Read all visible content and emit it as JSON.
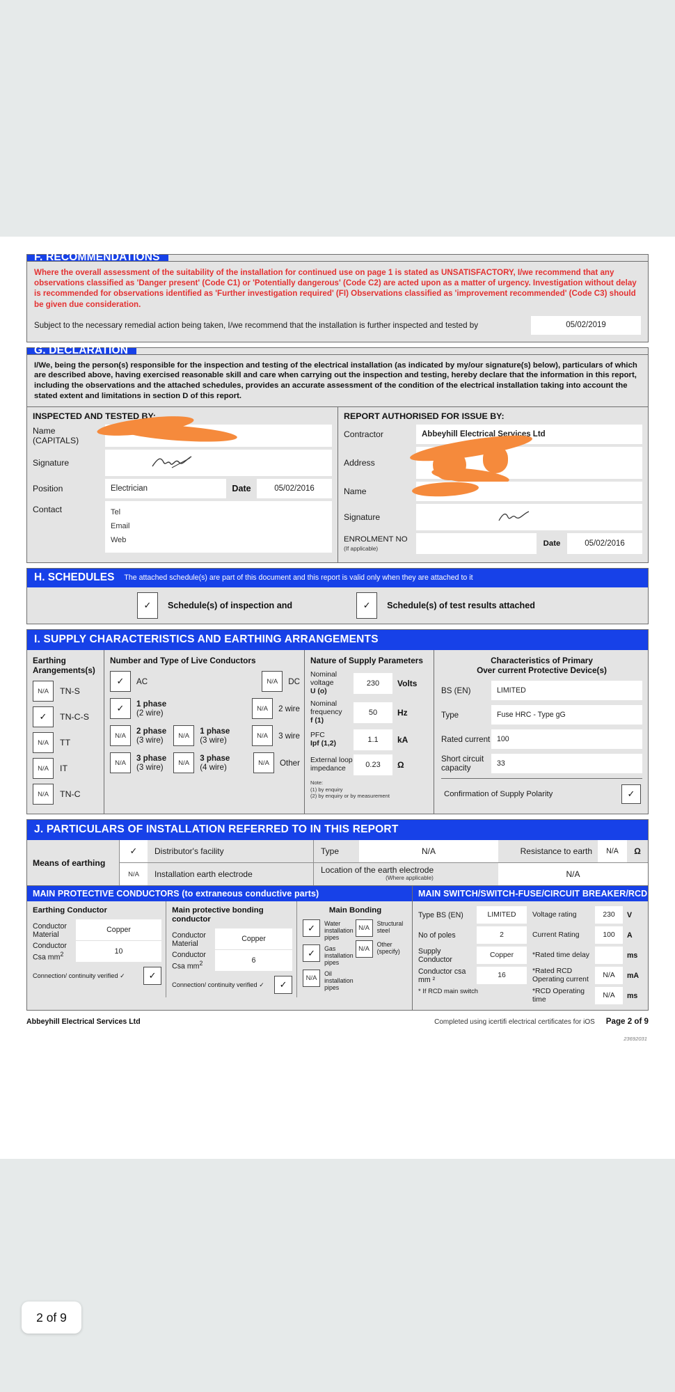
{
  "viewer": {
    "page_indicator": "2 of 9"
  },
  "sectionF": {
    "tab": "F. RECOMMENDATIONS",
    "warning": "Where the overall assessment of the suitability of the installation for continued use on page 1 is stated as UNSATISFACTORY, I/we recommend that any observations classified as 'Danger present' (Code C1) or 'Potentially dangerous' (Code C2) are acted upon as a matter of urgency.  Investigation without delay is recommended for observations identified as 'Further investigation required' (FI) Observations classified as 'improvement recommended' (Code C3) should be given due consideration.",
    "subject_text": "Subject to the necessary remedial action being taken, I/we recommend that the installation is further inspected and tested by",
    "retest_date": "05/02/2019"
  },
  "sectionG": {
    "tab": "G. DECLARATION",
    "declaration": "I/We, being the person(s) responsible for the inspection and testing of the electrical installation (as indicated by my/our signature(s) below), particulars of which are described above, having exercised reasonable skill and care when carrying out the inspection and testing, hereby declare that the information in this report, including the observations and the attached schedules, provides an accurate assessment of the condition of the electrical installation taking into account the stated extent and limitations in section D of this report.",
    "inspected": {
      "heading": "INSPECTED AND TESTED BY:",
      "name_label": "Name",
      "name_sub": "(CAPITALS)",
      "name_value": "",
      "signature_label": "Signature",
      "position_label": "Position",
      "position_value": "Electrician",
      "date_label": "Date",
      "date_value": "05/02/2016",
      "contact_label": "Contact",
      "contact_rows": [
        "Tel",
        "Email",
        "Web"
      ]
    },
    "authorised": {
      "heading": "REPORT AUTHORISED FOR ISSUE BY:",
      "contractor_label": "Contractor",
      "contractor_value": "Abbeyhill Electrical Services Ltd",
      "address_label": "Address",
      "address_value": "",
      "name_label": "Name",
      "name_value": "",
      "signature_label": "Signature",
      "enrolment_label": "ENROLMENT NO",
      "enrolment_sub": "(If applicable)",
      "enrolment_value": "",
      "date_label": "Date",
      "date_value": "05/02/2016"
    }
  },
  "sectionH": {
    "title": "H. SCHEDULES",
    "subtitle": "The attached schedule(s) are part of this document and this report is valid only when they are attached to it",
    "items": [
      {
        "state": "✓",
        "label": "Schedule(s) of inspection and"
      },
      {
        "state": "✓",
        "label": "Schedule(s) of test results attached"
      }
    ]
  },
  "sectionI": {
    "title": "I. SUPPLY CHARACTERISTICS AND EARTHING ARRANGEMENTS",
    "earthing": {
      "heading": "Earthing Arangements(s)",
      "items": [
        {
          "state": "N/A",
          "label": "TN-S"
        },
        {
          "state": "✓",
          "label": "TN-C-S"
        },
        {
          "state": "N/A",
          "label": "TT"
        },
        {
          "state": "N/A",
          "label": "IT"
        },
        {
          "state": "N/A",
          "label": "TN-C"
        }
      ]
    },
    "conductors": {
      "heading": "Number and Type of Live Conductors",
      "rows": [
        [
          {
            "state": "✓",
            "label": "AC",
            "bold": ""
          },
          {
            "state": "N/A",
            "label": "DC",
            "bold": ""
          }
        ],
        [
          {
            "state": "✓",
            "label": "(2 wire)",
            "bold": "1 phase"
          },
          {
            "state": "N/A",
            "label": "2 wire",
            "bold": ""
          }
        ],
        [
          {
            "state": "N/A",
            "label": "(3 wire)",
            "bold": "2 phase"
          },
          {
            "state": "N/A",
            "label": "(3 wire)",
            "bold": "1 phase"
          },
          {
            "state": "N/A",
            "label": "3 wire",
            "bold": ""
          }
        ],
        [
          {
            "state": "N/A",
            "label": "(3 wire)",
            "bold": "3 phase"
          },
          {
            "state": "N/A",
            "label": "(4 wire)",
            "bold": "3 phase"
          },
          {
            "state": "N/A",
            "label": "Other",
            "bold": ""
          }
        ]
      ]
    },
    "supply": {
      "heading": "Nature of Supply Parameters",
      "params": [
        {
          "label": "Nominal voltage",
          "bold": "U (o)",
          "value": "230",
          "unit": "Volts"
        },
        {
          "label": "Nominal frequency",
          "bold": "f (1)",
          "value": "50",
          "unit": "Hz"
        },
        {
          "label": "PFC",
          "bold": "Ipf (1,2)",
          "value": "1.1",
          "unit": "kA"
        },
        {
          "label": "External loop impedance",
          "bold": "",
          "value": "0.23",
          "unit": "Ω"
        }
      ],
      "note": "Note:\n(1) by enquiry\n(2) by enquiry or by measurement",
      "note_lines": [
        "Note:",
        "(1) by enquiry",
        "(2) by enquiry or by measurement"
      ]
    },
    "device": {
      "heading_line1": "Characteristics of Primary",
      "heading_line2": "Over current Protective Device(s)",
      "rows": [
        {
          "label": "BS (EN)",
          "value": "LIMITED"
        },
        {
          "label": "Type",
          "value": "Fuse HRC - Type gG"
        },
        {
          "label": "Rated current",
          "value": "100"
        },
        {
          "label": "Short circuit capacity",
          "value": "33"
        }
      ],
      "polarity_label": "Confirmation of Supply Polarity",
      "polarity_state": "✓"
    }
  },
  "sectionJ": {
    "title": "J. PARTICULARS OF INSTALLATION REFERRED TO IN THIS REPORT",
    "means_label": "Means of earthing",
    "row1": {
      "chk": "✓",
      "label": "Distributor's facility",
      "type_label": "Type",
      "type_value": "N/A",
      "resistance_label": "Resistance to earth",
      "resistance_value": "N/A",
      "resistance_unit": "Ω"
    },
    "row2": {
      "chk": "N/A",
      "label": "Installation earth electrode",
      "location_label": "Location of the earth electrode",
      "location_sub": "(Where applicable)",
      "location_value": "N/A"
    },
    "mpc_title": "MAIN PROTECTIVE CONDUCTORS (to extraneous conductive parts)",
    "ms_title": "MAIN SWITCH/SWITCH-FUSE/CIRCUIT BREAKER/RCD",
    "earthing_conductor": {
      "heading": "Earthing Conductor",
      "material_label": "Conductor Material",
      "material_value": "Copper",
      "csa_label": "Conductor Csa mm",
      "csa_sup": "2",
      "csa_value": "10",
      "verified_label": "Connection/ continuity verified ✓",
      "verified_state": "✓"
    },
    "bonding_conductor": {
      "heading": "Main protective bonding conductor",
      "material_label": "Conductor Material",
      "material_value": "Copper",
      "csa_label": "Conductor Csa mm",
      "csa_sup": "2",
      "csa_value": "6",
      "verified_label": "Connection/ continuity verified ✓",
      "verified_state": "✓"
    },
    "main_bonding": {
      "heading": "Main Bonding",
      "left": [
        {
          "state": "✓",
          "label": "Water installation pipes"
        },
        {
          "state": "✓",
          "label": "Gas installation pipes"
        },
        {
          "state": "N/A",
          "label": "Oil installation pipes"
        }
      ],
      "right": [
        {
          "state": "N/A",
          "label": "Structural steel"
        },
        {
          "state": "N/A",
          "label": "Other (specify)"
        }
      ]
    },
    "main_switch": {
      "left_rows": [
        {
          "label": "Type BS (EN)",
          "value": "LIMITED"
        },
        {
          "label": "No of poles",
          "value": "2"
        },
        {
          "label": "Supply Conductor",
          "value": "Copper"
        },
        {
          "label": "Conductor csa mm ²",
          "value": "16"
        }
      ],
      "right_rows": [
        {
          "label": "Voltage rating",
          "value": "230",
          "unit": "V"
        },
        {
          "label": "Current Rating",
          "value": "100",
          "unit": "A"
        },
        {
          "label": "*Rated time delay",
          "value": "",
          "unit": "ms"
        },
        {
          "label": "*Rated RCD Operating current",
          "value": "N/A",
          "unit": "mA"
        },
        {
          "label": "*RCD Operating time",
          "value": "N/A",
          "unit": "ms"
        }
      ],
      "footnote": "* If RCD main switch"
    }
  },
  "footer": {
    "company": "Abbeyhill Electrical Services Ltd",
    "credit": "Completed using icertifi electrical certificates for iOS",
    "page": "Page 2 of 9",
    "doc_id": "23692031"
  }
}
